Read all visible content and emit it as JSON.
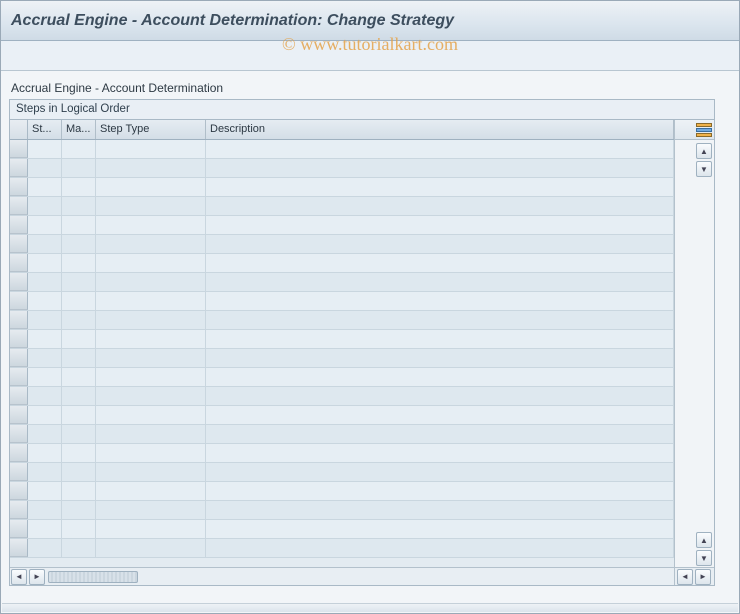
{
  "header": {
    "title": "Accrual Engine - Account Determination: Change Strategy"
  },
  "watermark": "© www.tutorialkart.com",
  "section": {
    "label": "Accrual Engine - Account Determination"
  },
  "panel": {
    "title": "Steps in Logical Order"
  },
  "columns": {
    "step": "St...",
    "main": "Ma...",
    "stepType": "Step Type",
    "description": "Description"
  },
  "rows": []
}
